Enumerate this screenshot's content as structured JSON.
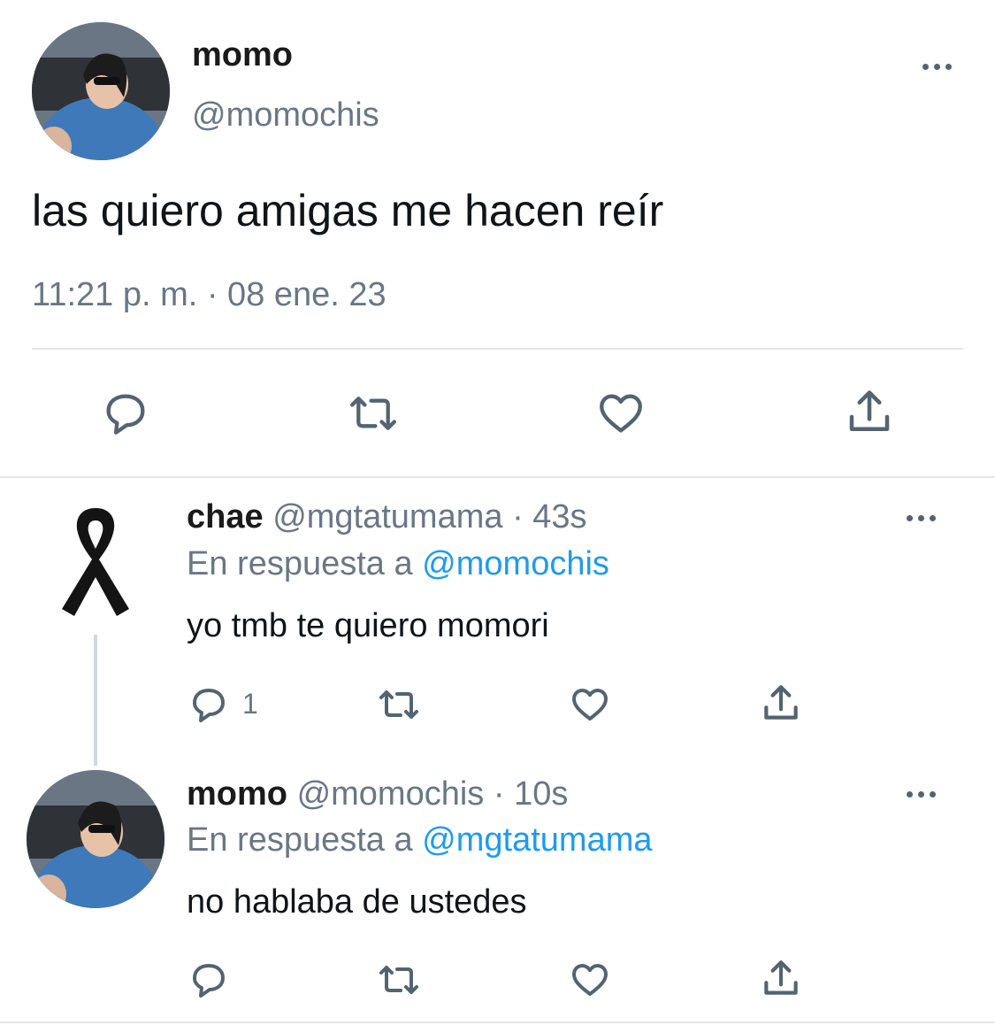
{
  "main_tweet": {
    "display_name": "momo",
    "handle": "@momochis",
    "text": "las quiero amigas me hacen reír",
    "timestamp": "11:21 p. m. · 08 ene. 23",
    "actions": [
      "reply-icon",
      "retweet-icon",
      "like-icon",
      "share-icon"
    ]
  },
  "replies": [
    {
      "display_name": "chae",
      "handle": "@mgtatumama",
      "time": "· 43s",
      "reply_prefix": "En respuesta a",
      "reply_to": "@momochis",
      "text": "yo tmb te quiero momori",
      "reply_count": "1",
      "avatar": "black-ribbon-icon"
    },
    {
      "display_name": "momo",
      "handle": "@momochis",
      "time": "· 10s",
      "reply_prefix": "En respuesta a",
      "reply_to": "@mgtatumama",
      "text": "no hablaba de ustedes",
      "reply_count": "",
      "avatar": "user-photo"
    }
  ],
  "colors": {
    "accent": "#1d9bf0",
    "muted": "#697785",
    "icon": "#536471",
    "divider": "#e4e7ea"
  }
}
